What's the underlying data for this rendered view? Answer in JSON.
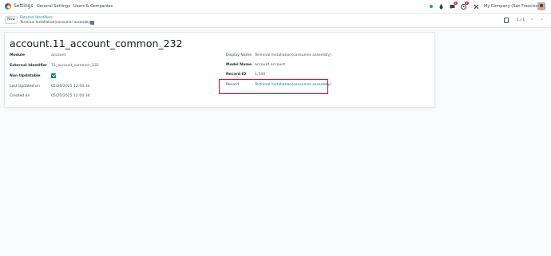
{
  "topbar": {
    "app_name": "Settings",
    "menu": [
      "General Settings",
      "Users & Companies"
    ],
    "messages_badge": "5",
    "activity_badge": "1",
    "company": "My Company (San Francisco)"
  },
  "control_panel": {
    "new_label": "New",
    "breadcrumb_parent": "External Identifiers",
    "breadcrumb_current": "Terminal Installation(consumer assembly)",
    "pager": "1 / 1"
  },
  "form": {
    "title": "account.11_account_common_232",
    "left": [
      {
        "label": "Module",
        "value": "account"
      },
      {
        "label": "External Identifier",
        "value": "11_account_common_232"
      },
      {
        "label": "Non Updatable",
        "value": ""
      },
      {
        "label": "Last Updated on",
        "value": "05/20/2025 12:04:34"
      },
      {
        "label": "Created on",
        "value": "05/20/2025 12:04:34"
      }
    ],
    "right": [
      {
        "label": "Display Name",
        "value": "Terminal Installation(consumer assembly)"
      },
      {
        "label": "Model Name",
        "value": "account.account"
      },
      {
        "label": "Record ID",
        "value": "1,540"
      },
      {
        "label": "Record",
        "value": "Terminal Installation(consumer assembly)"
      }
    ],
    "non_updatable_checked": true
  },
  "colors": {
    "accent": "#017e84",
    "highlight": "#e0001b"
  }
}
